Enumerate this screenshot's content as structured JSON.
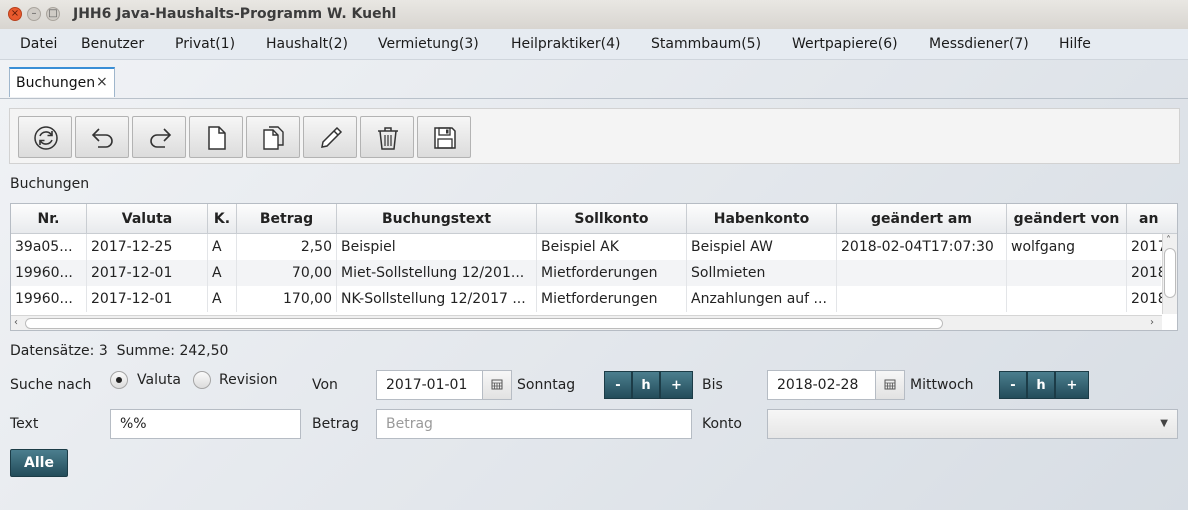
{
  "window": {
    "title": "JHH6 Java-Haushalts-Programm W. Kuehl",
    "close_glyph": "×",
    "minimize_glyph": "–",
    "maximize_glyph": "□"
  },
  "menu": [
    "Datei",
    "Benutzer",
    "Privat(1)",
    "Haushalt(2)",
    "Vermietung(3)",
    "Heilpraktiker(4)",
    "Stammbaum(5)",
    "Wertpapiere(6)",
    "Messdiener(7)",
    "Hilfe"
  ],
  "tab": {
    "label": "Buchungen",
    "close_glyph": "×"
  },
  "toolbar": {
    "icons": [
      "refresh-icon",
      "undo-icon",
      "redo-icon",
      "new-document-icon",
      "copy-document-icon",
      "edit-pencil-icon",
      "trash-icon",
      "save-disk-icon"
    ]
  },
  "section_label": "Buchungen",
  "table": {
    "columns": [
      "Nr.",
      "Valuta",
      "K.",
      "Betrag",
      "Buchungstext",
      "Sollkonto",
      "Habenkonto",
      "geändert am",
      "geändert von",
      "an"
    ],
    "rows": [
      [
        "39a05...",
        "2017-12-25",
        "A",
        "2,50",
        "Beispiel",
        "Beispiel AK",
        "Beispiel AW",
        "2018-02-04T17:07:30",
        "wolfgang",
        "2017"
      ],
      [
        "19960...",
        "2017-12-01",
        "A",
        "70,00",
        "Miet-Sollstellung 12/201...",
        "Mietforderungen",
        "Sollmieten",
        "",
        "",
        "2018"
      ],
      [
        "19960...",
        "2017-12-01",
        "A",
        "170,00",
        "NK-Sollstellung 12/2017 ...",
        "Mietforderungen",
        "Anzahlungen auf ...",
        "",
        "",
        "2018"
      ]
    ]
  },
  "status": {
    "text": "Datensätze: 3  Summe: 242,50"
  },
  "filters": {
    "search_label": "Suche nach",
    "radio_valuta": "Valuta",
    "radio_revision": "Revision",
    "selected": "Valuta",
    "von_label": "Von",
    "von_value": "2017-01-01",
    "von_weekday": "Sonntag",
    "bis_label": "Bis",
    "bis_value": "2018-02-28",
    "bis_weekday": "Mittwoch",
    "step_minus": "-",
    "step_h": "h",
    "step_plus": "+",
    "text_label": "Text",
    "text_value": "%%",
    "betrag_label": "Betrag",
    "betrag_placeholder": "Betrag",
    "konto_label": "Konto",
    "konto_value": ""
  },
  "alle_button": "Alle"
}
